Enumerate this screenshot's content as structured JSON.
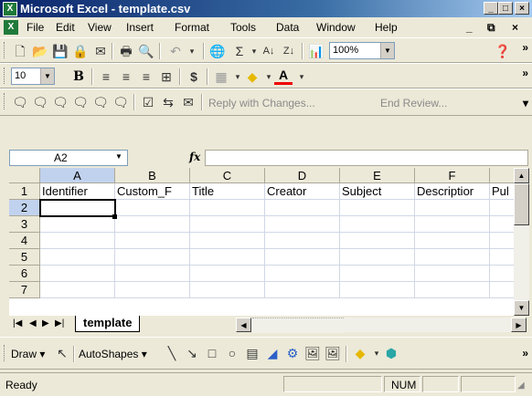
{
  "window": {
    "title": "Microsoft Excel - template.csv",
    "icon": "excel-icon"
  },
  "menu": [
    "File",
    "Edit",
    "View",
    "Insert",
    "Format",
    "Tools",
    "Data",
    "Window",
    "Help"
  ],
  "toolbar_font": {
    "size": "10",
    "bold": "B"
  },
  "toolbar_standard": {
    "zoom": "100%"
  },
  "review_toolbar": {
    "reply_label": "Reply with Changes...",
    "end_review_label": "End Review..."
  },
  "formula_bar": {
    "name_box": "A2",
    "fx": "fx",
    "content": ""
  },
  "grid": {
    "columns": [
      "A",
      "B",
      "C",
      "D",
      "E",
      "F"
    ],
    "rows": [
      "1",
      "2",
      "3",
      "4",
      "5",
      "6",
      "7"
    ],
    "row1": [
      "Identifier",
      "Custom_F",
      "Title",
      "Creator",
      "Subject",
      "Descriptior",
      "Pul"
    ],
    "active_cell": "A2"
  },
  "sheet": {
    "tab_label": "template"
  },
  "draw_toolbar": {
    "draw_label": "Draw",
    "autoshapes_label": "AutoShapes"
  },
  "status": {
    "ready": "Ready",
    "num": "NUM"
  }
}
